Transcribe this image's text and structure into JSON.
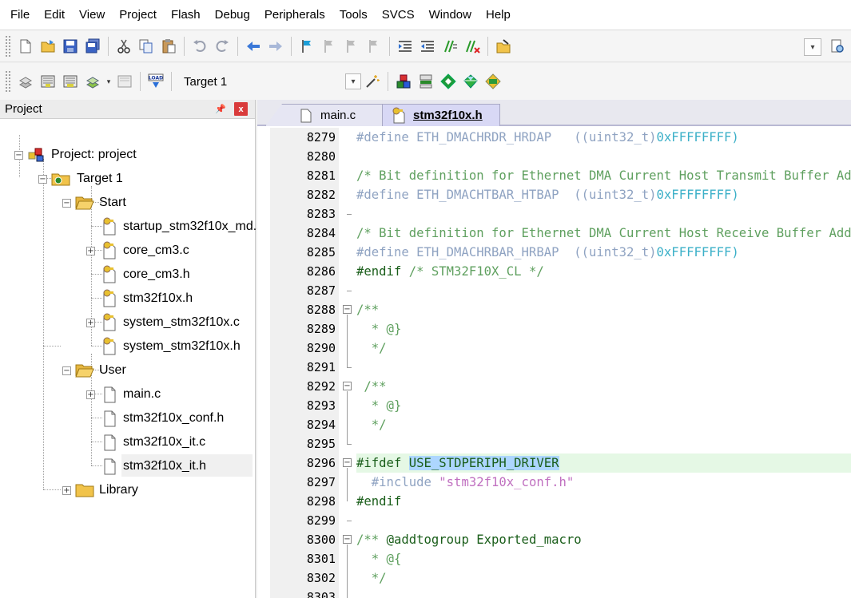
{
  "menu": [
    "File",
    "Edit",
    "View",
    "Project",
    "Flash",
    "Debug",
    "Peripherals",
    "Tools",
    "SVCS",
    "Window",
    "Help"
  ],
  "toolbar": {
    "target_name": "Target 1",
    "load_label": "LOAD"
  },
  "project_panel": {
    "title": "Project",
    "pin_glyph": "📌",
    "close_glyph": "x",
    "tree": {
      "root": "Project: project",
      "target": "Target 1",
      "groups": [
        {
          "name": "Start",
          "files": [
            "startup_stm32f10x_md.s",
            "core_cm3.c",
            "core_cm3.h",
            "stm32f10x.h",
            "system_stm32f10x.c",
            "system_stm32f10x.h"
          ]
        },
        {
          "name": "User",
          "files": [
            "main.c",
            "stm32f10x_conf.h",
            "stm32f10x_it.c",
            "stm32f10x_it.h"
          ]
        },
        {
          "name": "Library",
          "files": []
        }
      ]
    }
  },
  "editor": {
    "tabs": [
      "main.c",
      "stm32f10x.h"
    ],
    "active_tab": "stm32f10x.h",
    "line_numbers": [
      "8279",
      "8280",
      "8281",
      "8282",
      "8283",
      "8284",
      "8285",
      "8286",
      "8287",
      "8288",
      "8289",
      "8290",
      "8291",
      "8292",
      "8293",
      "8294",
      "8295",
      "8296",
      "8297",
      "8298",
      "8299",
      "8300",
      "8301",
      "8302",
      "8303"
    ],
    "code": {
      "l8279_def": "#define ETH_DMACHRDR_HRDAP   ((uint32_t)",
      "l8279_hex": "0xFFFFFFFF)",
      "l8281": "/* Bit definition for Ethernet DMA Current Host Transmit Buffer Address Register */",
      "l8282_def": "#define ETH_DMACHTBAR_HTBAP  ((uint32_t)",
      "l8282_hex": "0xFFFFFFFF)",
      "l8284": "/* Bit definition for Ethernet DMA Current Host Receive Buffer Address Register */",
      "l8285_def": "#define ETH_DMACHRBAR_HRBAP  ((uint32_t)",
      "l8285_hex": "0xFFFFFFFF)",
      "l8286_kw": "#endif",
      "l8286_com": " /* STM32F10X_CL */",
      "l8288": "/**",
      "l8289": "  * @}",
      "l8290": "  */",
      "l8292": " /**",
      "l8293": "  * @}",
      "l8294": "  */",
      "l8296_kw": "#ifdef",
      "l8296_sym": "USE_STDPERIPH_DRIVER",
      "l8297_kw": "  #include",
      "l8297_str": "\"stm32f10x_conf.h\"",
      "l8298": "#endif",
      "l8300_a": "/** ",
      "l8300_b": "@addtogroup Exported_macro",
      "l8301": "  * @{",
      "l8302": "  */"
    }
  },
  "colors": {
    "highlight_line": "#e5f8e5",
    "highlight_word": "#add6ff",
    "comment": "#5fa05f",
    "preprocessor": "#8fa3c2",
    "hex": "#3cb0c8",
    "string": "#c070c0"
  }
}
